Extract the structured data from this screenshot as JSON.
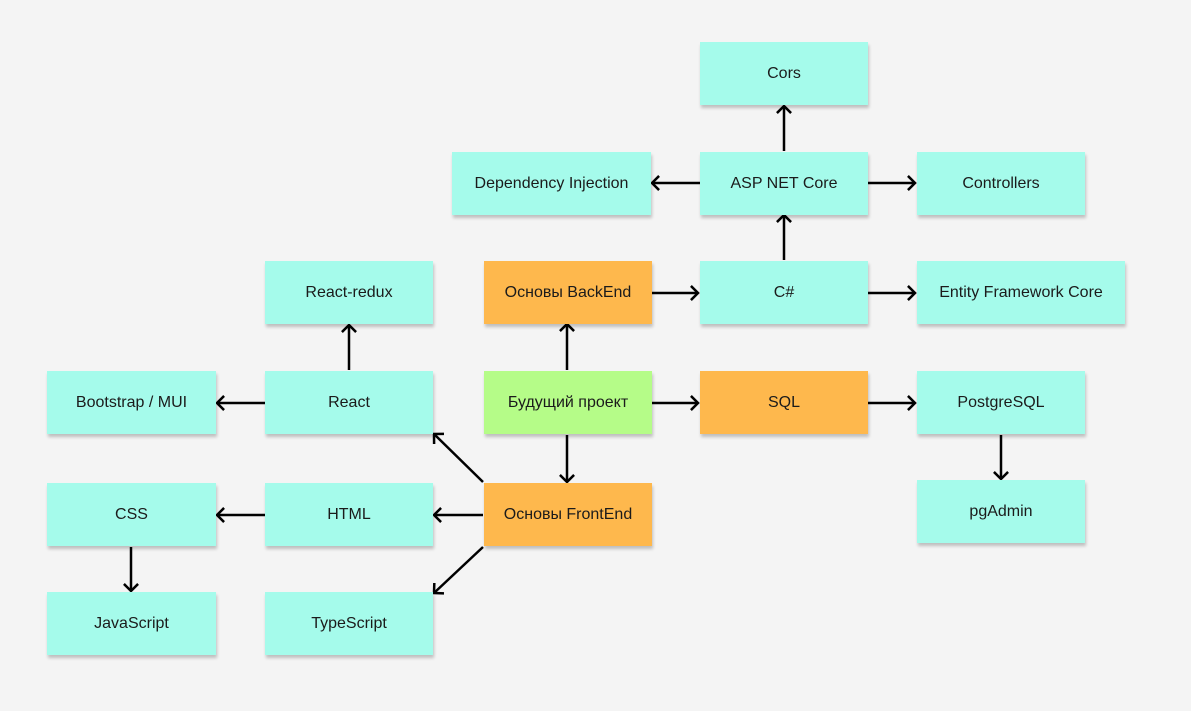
{
  "diagram": {
    "colors": {
      "background": "#f4f4f4",
      "topic": "#a5fbeb",
      "section": "#feb84d",
      "root": "#b5fc88",
      "edge": "#000000"
    },
    "nodes": [
      {
        "id": "cors",
        "label": "Cors",
        "kind": "topic"
      },
      {
        "id": "di",
        "label": "Dependency Injection",
        "kind": "topic"
      },
      {
        "id": "aspnet",
        "label": "ASP NET Core",
        "kind": "topic"
      },
      {
        "id": "controllers",
        "label": "Controllers",
        "kind": "topic"
      },
      {
        "id": "redux",
        "label": "React-redux",
        "kind": "topic"
      },
      {
        "id": "backend",
        "label": "Основы BackEnd",
        "kind": "section"
      },
      {
        "id": "csharp",
        "label": "C#",
        "kind": "topic"
      },
      {
        "id": "efcore",
        "label": "Entity Framework Core",
        "kind": "topic"
      },
      {
        "id": "bootstrap",
        "label": "Bootstrap / MUI",
        "kind": "topic"
      },
      {
        "id": "react",
        "label": "React",
        "kind": "topic"
      },
      {
        "id": "project",
        "label": "Будущий проект",
        "kind": "root"
      },
      {
        "id": "sql",
        "label": "SQL",
        "kind": "section"
      },
      {
        "id": "postgres",
        "label": "PostgreSQL",
        "kind": "topic"
      },
      {
        "id": "css",
        "label": "CSS",
        "kind": "topic"
      },
      {
        "id": "html",
        "label": "HTML",
        "kind": "topic"
      },
      {
        "id": "frontend",
        "label": "Основы FrontEnd",
        "kind": "section"
      },
      {
        "id": "pgadmin",
        "label": "pgAdmin",
        "kind": "topic"
      },
      {
        "id": "js",
        "label": "JavaScript",
        "kind": "topic"
      },
      {
        "id": "ts",
        "label": "TypeScript",
        "kind": "topic"
      }
    ],
    "edges": [
      {
        "from": "project",
        "to": "backend"
      },
      {
        "from": "project",
        "to": "sql"
      },
      {
        "from": "project",
        "to": "frontend"
      },
      {
        "from": "backend",
        "to": "csharp"
      },
      {
        "from": "csharp",
        "to": "aspnet"
      },
      {
        "from": "csharp",
        "to": "efcore"
      },
      {
        "from": "aspnet",
        "to": "cors"
      },
      {
        "from": "aspnet",
        "to": "di"
      },
      {
        "from": "aspnet",
        "to": "controllers"
      },
      {
        "from": "sql",
        "to": "postgres"
      },
      {
        "from": "postgres",
        "to": "pgadmin"
      },
      {
        "from": "frontend",
        "to": "react"
      },
      {
        "from": "frontend",
        "to": "html"
      },
      {
        "from": "frontend",
        "to": "ts"
      },
      {
        "from": "react",
        "to": "redux"
      },
      {
        "from": "react",
        "to": "bootstrap"
      },
      {
        "from": "html",
        "to": "css"
      },
      {
        "from": "css",
        "to": "js"
      }
    ]
  }
}
